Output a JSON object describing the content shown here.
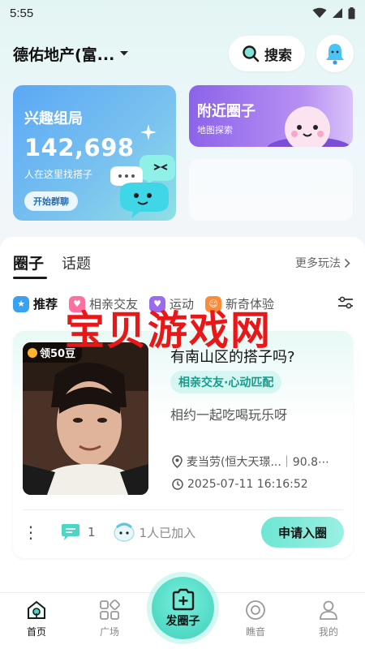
{
  "status": {
    "time": "5:55"
  },
  "header": {
    "location": "德佑地产(富...",
    "search_label": "搜索"
  },
  "cards": {
    "interest": {
      "title": "兴趣组局",
      "count": "142,698",
      "subtitle": "人在这里找搭子",
      "button": "开始群聊"
    },
    "nearby": {
      "title": "附近圈子",
      "subtitle": "地图探索"
    }
  },
  "tabs": {
    "active": "圈子",
    "other": "话题",
    "more": "更多玩法"
  },
  "chips": [
    {
      "label": "推荐",
      "color": "#3aa0f0"
    },
    {
      "label": "相亲交友",
      "color": "#ff6fa0"
    },
    {
      "label": "运动",
      "color": "#9a6af0"
    },
    {
      "label": "新奇体验",
      "color": "#ff8a3a"
    }
  ],
  "post": {
    "bean_badge": "领50豆",
    "title": "有南山区的搭子吗?",
    "tag": "相亲交友·心动匹配",
    "description": "相约一起吃喝玩乐呀",
    "location": "麦当劳(恒大天璟...｜90.8⋯",
    "time": "2025-07-11 16:16:52",
    "comments": "1",
    "joined": "1人已加入",
    "apply_button": "申请入圈"
  },
  "watermark": "宝贝游戏网",
  "bottom_nav": {
    "home": "首页",
    "square": "广场",
    "publish": "发圈子",
    "voice": "瞧音",
    "mine": "我的"
  }
}
